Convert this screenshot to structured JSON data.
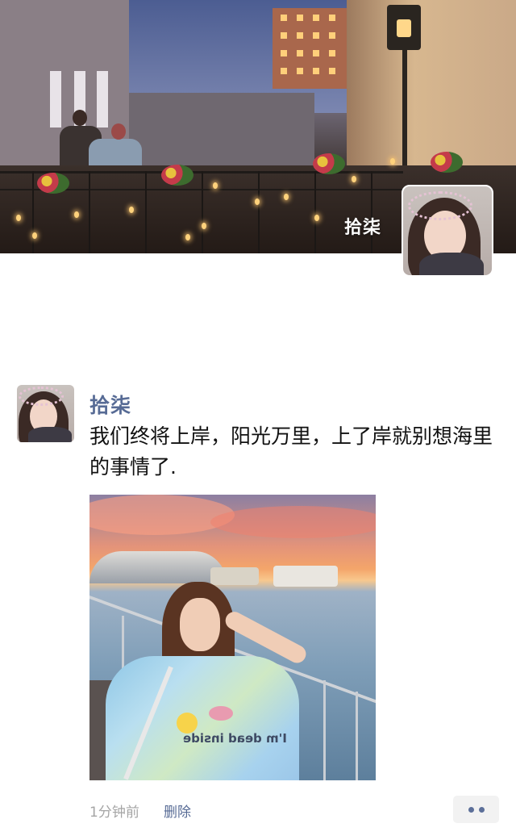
{
  "cover": {
    "user_name": "拾柒"
  },
  "moment": {
    "author": "拾柒",
    "text": "我们终将上岸，阳光万里，上了岸就别想海里的事情了.",
    "photo_print": "I'm dead inside",
    "time": "1分钟前",
    "delete_label": "删除"
  },
  "icons": {
    "more": "more-dots-icon"
  },
  "colors": {
    "link": "#576b95",
    "meta": "#a5a5a5"
  }
}
